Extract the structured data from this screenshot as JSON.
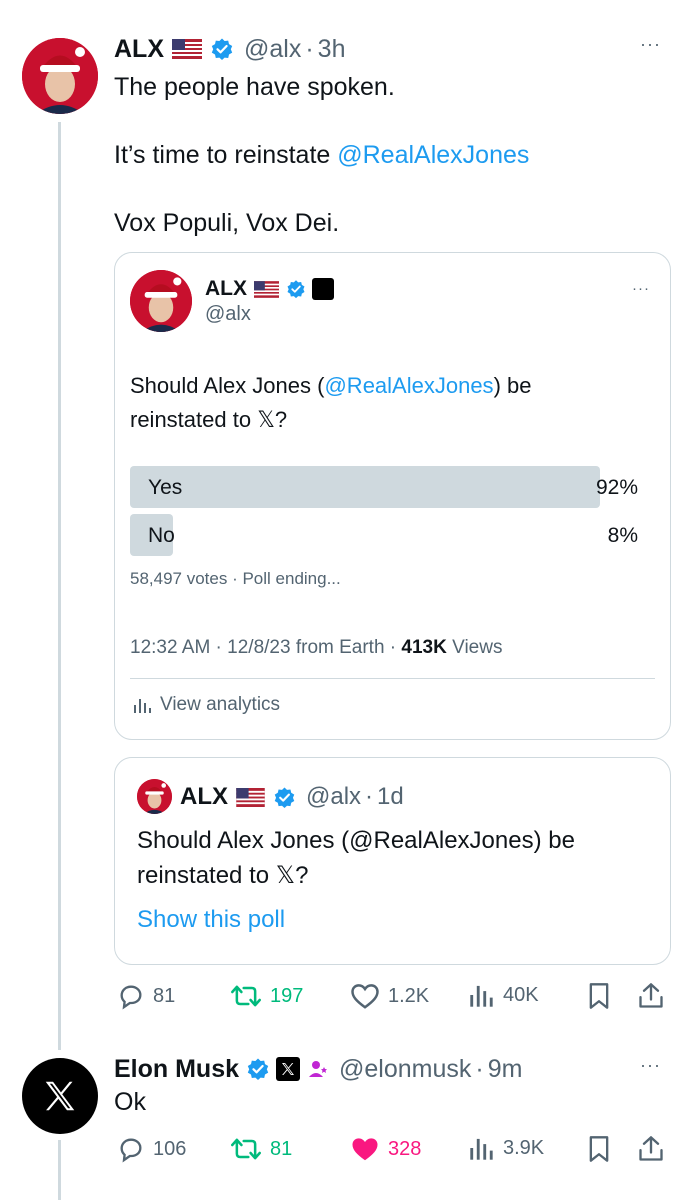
{
  "main_tweet": {
    "author_name": "ALX",
    "author_handle": "@alx",
    "time": "3h",
    "lines": [
      "The people have spoken."
    ],
    "line2_prefix": "It’s time to reinstate ",
    "line2_mention": "@RealAlexJones",
    "line3": "Vox Populi, Vox Dei."
  },
  "quote": {
    "author_name": "ALX",
    "author_handle": "@alx",
    "text_prefix": "Should Alex Jones (",
    "text_mention": "@RealAlexJones",
    "text_suffix": ") be",
    "text_line2": "reinstated to 𝕏?",
    "poll": {
      "options": [
        {
          "label": "Yes",
          "percent": "92%",
          "fraction": 0.92
        },
        {
          "label": "No",
          "percent": "8%",
          "fraction": 0.08
        }
      ],
      "votes": "58,497 votes",
      "status": "Poll ending..."
    },
    "timestamp": "12:32 AM · 12/8/23 from Earth · ",
    "views_count": "413K",
    "views_label": " Views",
    "analytics_label": "View analytics"
  },
  "quote2": {
    "author_name": "ALX",
    "author_handle": "@alx",
    "time": "1d",
    "text_line1": "Should Alex Jones (@RealAlexJones) be",
    "text_line2": "reinstated to 𝕏?",
    "show_poll": "Show this poll"
  },
  "main_actions": {
    "replies": "81",
    "retweets": "197",
    "likes": "1.2K",
    "views": "40K"
  },
  "reply": {
    "author_name": "Elon Musk",
    "author_handle": "@elonmusk",
    "time": "9m",
    "text": "Ok",
    "replies": "106",
    "retweets": "81",
    "likes": "328",
    "views": "3.9K"
  },
  "colors": {
    "link": "#1d9bf0",
    "retweet": "#00ba7c",
    "like": "#f91880",
    "muted": "#536471"
  }
}
